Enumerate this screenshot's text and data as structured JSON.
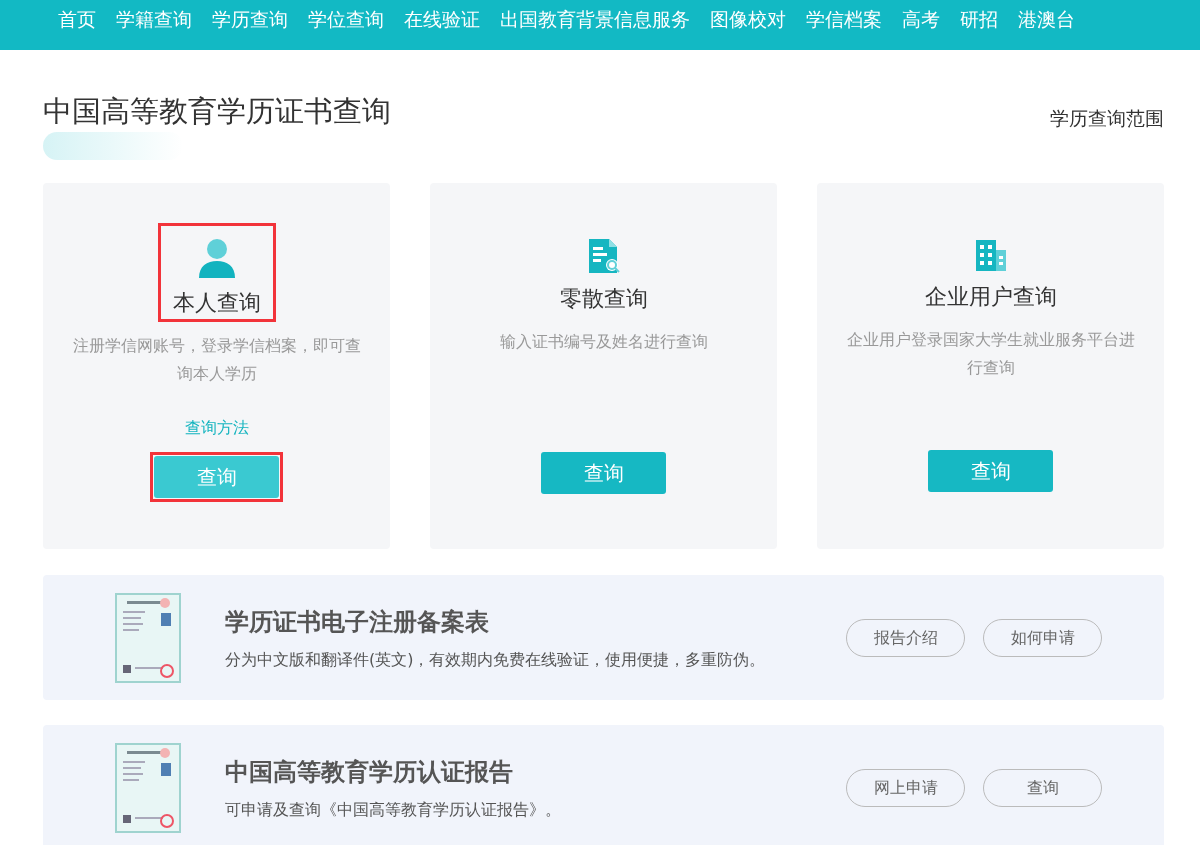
{
  "nav": {
    "items": [
      {
        "label": "首页"
      },
      {
        "label": "学籍查询"
      },
      {
        "label": "学历查询"
      },
      {
        "label": "学位查询"
      },
      {
        "label": "在线验证"
      },
      {
        "label": "出国教育背景信息服务"
      },
      {
        "label": "图像校对"
      },
      {
        "label": "学信档案"
      },
      {
        "label": "高考"
      },
      {
        "label": "研招"
      },
      {
        "label": "港澳台"
      }
    ]
  },
  "page": {
    "title": "中国高等教育学历证书查询",
    "scope_link": "学历查询范围"
  },
  "cards": [
    {
      "kind": "person",
      "title": "本人查询",
      "description": "注册学信网账号，登录学信档案，即可查询本人学历",
      "link": "查询方法",
      "button": "查询",
      "highlighted": true
    },
    {
      "kind": "document",
      "title": "零散查询",
      "description": "输入证书编号及姓名进行查询",
      "button": "查询",
      "highlighted": false
    },
    {
      "kind": "building",
      "title": "企业用户查询",
      "description": "企业用户登录国家大学生就业服务平台进行查询",
      "button": "查询",
      "highlighted": false
    }
  ],
  "banners": [
    {
      "kind": "picture",
      "title": "学历证书电子注册备案表",
      "description": "分为中文版和翻译件(英文)，有效期内免费在线验证，使用便捷，多重防伪。",
      "buttons": [
        "报告介绍",
        "如何申请"
      ]
    },
    {
      "kind": "picture",
      "title": "中国高等教育学历认证报告",
      "description": "可申请及查询《中国高等教育学历认证报告》。",
      "buttons": [
        "网上申请",
        "查询"
      ]
    }
  ]
}
